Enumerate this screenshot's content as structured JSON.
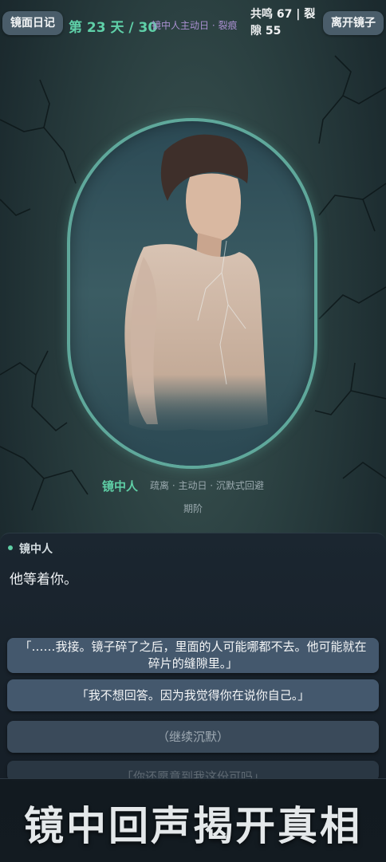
{
  "topbar": {
    "diary_button": "镜面日记",
    "day_label": "第 23 天 / 30",
    "mode_label": "镜中人主动日 · 裂痕",
    "stats_label": "共鸣 67 | 裂隙 55",
    "leave_button": "离开镜子"
  },
  "character": {
    "name": "镜中人",
    "traits": "疏离 · 主动日 · 沉默式回避",
    "stage": "期阶"
  },
  "dialogue": {
    "speaker": "镜中人",
    "line": "他等着你。",
    "choices": [
      {
        "label": "「……我接。镜子碎了之后，里面的人可能哪都不去。他可能就在碎片的缝隙里。」"
      },
      {
        "label": "「我不想回答。因为我觉得你在说你自己。」"
      },
      {
        "label": "（继续沉默）"
      },
      {
        "label": "「你还愿意到我这份可吗」"
      }
    ]
  },
  "footer": {
    "title": "镜中回声揭开真相"
  },
  "colors": {
    "accent": "#5fcfa6",
    "mode": "#a98fd0",
    "button": "#4a5d6a",
    "choice": "#44586d"
  }
}
